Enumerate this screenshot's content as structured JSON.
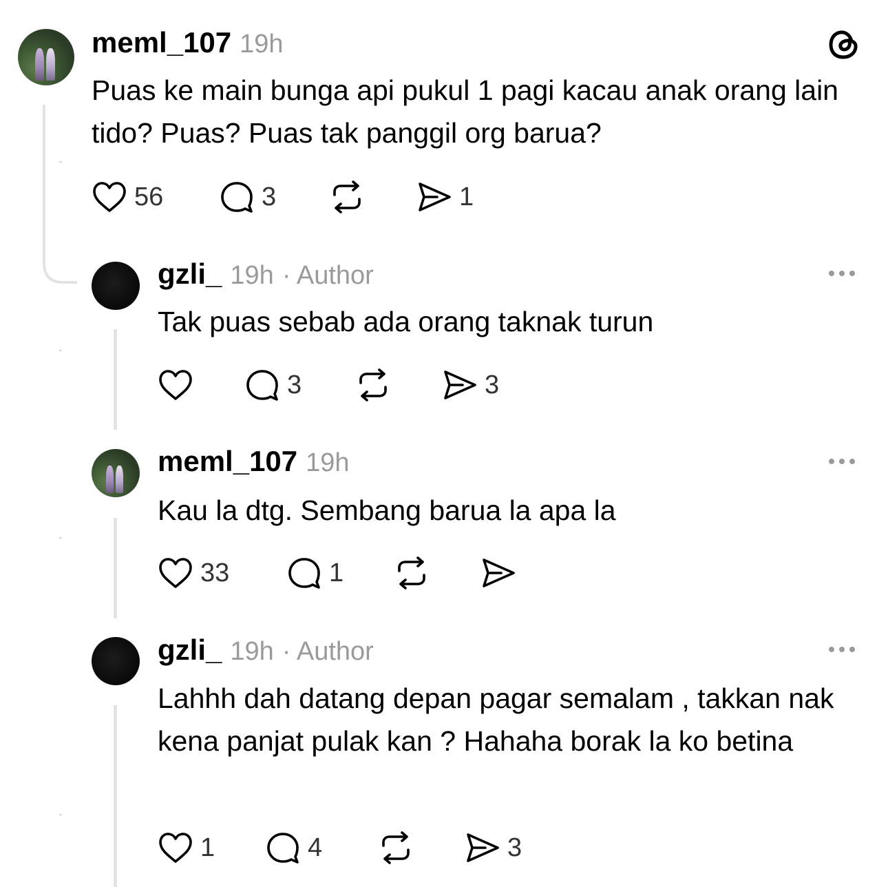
{
  "posts": [
    {
      "username": "meml_107",
      "time": "19h",
      "author_tag": "",
      "text": "Puas ke main bunga api pukul 1 pagi kacau anak orang lain tido? Puas? Puas tak panggil org barua?",
      "likes": "56",
      "replies": "3",
      "reposts": "",
      "shares": "1",
      "avatar_icon": "profile-photo-couple"
    },
    {
      "username": "gzli_",
      "time": "19h",
      "author_tag": "· Author",
      "text": "Tak puas sebab ada orang taknak turun",
      "likes": "",
      "replies": "3",
      "reposts": "",
      "shares": "3",
      "avatar_icon": "profile-photo-dark"
    },
    {
      "username": "meml_107",
      "time": "19h",
      "author_tag": "",
      "text": "Kau la dtg. Sembang barua la apa la",
      "likes": "33",
      "replies": "1",
      "reposts": "",
      "shares": "",
      "avatar_icon": "profile-photo-couple"
    },
    {
      "username": "gzli_",
      "time": "19h",
      "author_tag": "· Author",
      "text": "Lahhh dah datang depan pagar semalam , takkan nak kena panjat pulak kan ? Hahaha borak la ko betina",
      "likes": "1",
      "replies": "4",
      "reposts": "",
      "shares": "3",
      "avatar_icon": "profile-photo-dark"
    }
  ],
  "icons": {
    "app_logo": "threads-logo-icon",
    "like": "heart-icon",
    "reply": "comment-bubble-icon",
    "repost": "repost-icon",
    "share": "send-icon",
    "more": "more-options-icon"
  },
  "colors": {
    "text": "#000000",
    "meta": "#9a9a9a",
    "thread_line": "#e3e3e3",
    "background": "#ffffff"
  }
}
